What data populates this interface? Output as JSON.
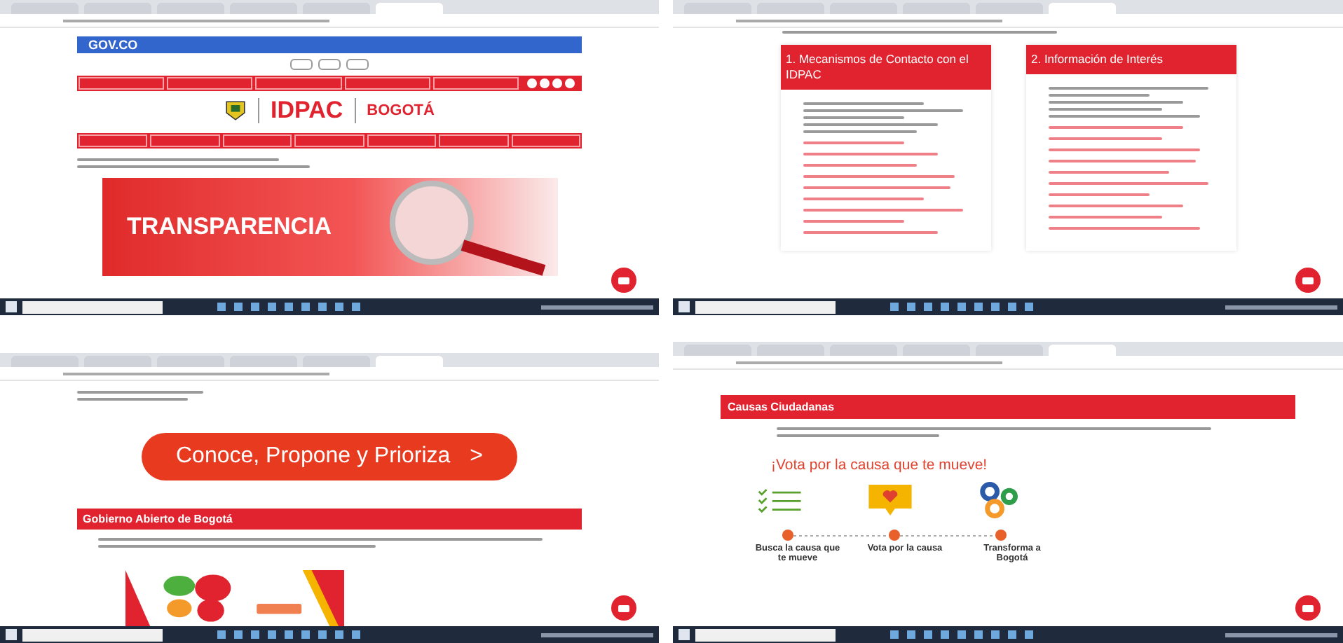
{
  "screens": [
    {
      "tabs": [
        {
          "selected": false
        },
        {
          "selected": false
        },
        {
          "selected": false
        },
        {
          "selected": false
        },
        {
          "selected": false
        },
        {
          "selected": true
        }
      ],
      "kind": "home",
      "gov_logo": "GOV.CO",
      "logo_text": "IDPAC",
      "city_text": "BOGOTÁ",
      "banner": "TRANSPARENCIA"
    },
    {
      "tabs": [
        {
          "selected": false
        },
        {
          "selected": false
        },
        {
          "selected": false
        },
        {
          "selected": false
        },
        {
          "selected": false
        },
        {
          "selected": true
        }
      ],
      "kind": "sections",
      "cards": [
        {
          "title": "1. Mecanismos de Contacto con el IDPAC"
        },
        {
          "title": "2. Información de Interés"
        }
      ]
    },
    {
      "tabs": [
        {
          "selected": false
        },
        {
          "selected": false
        },
        {
          "selected": false
        },
        {
          "selected": false
        },
        {
          "selected": false
        },
        {
          "selected": true
        }
      ],
      "kind": "cta",
      "button": "Conoce, Propone y Prioriza",
      "chevron": ">",
      "heading": "Gobierno Abierto de Bogotá"
    },
    {
      "tabs": [
        {
          "selected": false
        },
        {
          "selected": false
        },
        {
          "selected": false
        },
        {
          "selected": false
        },
        {
          "selected": false
        },
        {
          "selected": true
        }
      ],
      "kind": "causes",
      "heading": "Causas Ciudadanas",
      "slogan": "¡Vota por la causa que te mueve!",
      "steps": [
        {
          "label": "Busca la causa que te mueve"
        },
        {
          "label": "Vota por la causa"
        },
        {
          "label": "Transforma a Bogotá"
        }
      ]
    }
  ]
}
